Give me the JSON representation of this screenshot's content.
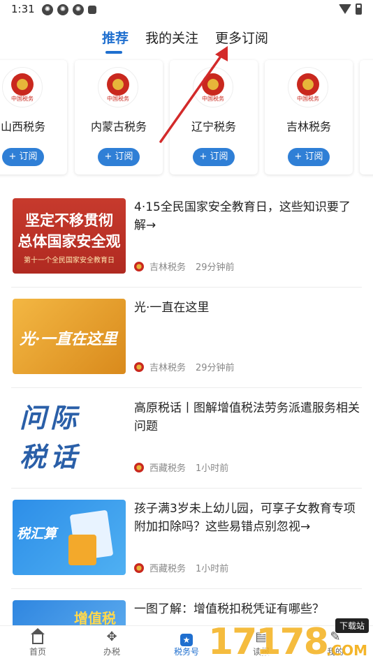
{
  "status": {
    "time": "1:31"
  },
  "tabs": [
    {
      "label": "推荐",
      "active": true
    },
    {
      "label": "我的关注",
      "active": false
    },
    {
      "label": "更多订阅",
      "active": false
    }
  ],
  "subscriptions": [
    {
      "name": "山西税务",
      "button": "+ 订阅"
    },
    {
      "name": "内蒙古税务",
      "button": "+ 订阅"
    },
    {
      "name": "辽宁税务",
      "button": "+ 订阅"
    },
    {
      "name": "吉林税务",
      "button": "+ 订阅"
    }
  ],
  "feed": [
    {
      "title": "4·15全民国家安全教育日，这些知识要了解→",
      "source": "吉林税务",
      "time": "29分钟前",
      "thumb": {
        "line1": "坚定不移贯彻",
        "line2": "总体国家安全观",
        "line3": "第十一个全民国家安全教育日"
      }
    },
    {
      "title": "光·一直在这里",
      "source": "吉林税务",
      "time": "29分钟前",
      "thumb": {
        "text": "光·一直在这里"
      }
    },
    {
      "title": "高原税话丨图解增值税法劳务派遣服务相关问题",
      "source": "西藏税务",
      "time": "1小时前",
      "thumb": {
        "line1": "问际",
        "line2": "税话"
      }
    },
    {
      "title": "孩子满3岁未上幼儿园，可享子女教育专项附加扣除吗？这些易错点别忽视→",
      "source": "西藏税务",
      "time": "1小时前",
      "thumb": {
        "text": "税汇算"
      }
    },
    {
      "title": "一图了解：增值税扣税凭证有哪些？",
      "source": "",
      "time": "",
      "thumb": {
        "text": "增值税"
      }
    }
  ],
  "bottom_nav": [
    {
      "label": "首页",
      "icon": "home-icon"
    },
    {
      "label": "办税",
      "icon": "handshake-icon"
    },
    {
      "label": "税务号",
      "icon": "star-badge-icon",
      "active": true
    },
    {
      "label": "读报",
      "icon": "book-icon"
    },
    {
      "label": "我的",
      "icon": "pen-icon"
    }
  ],
  "watermark": {
    "digits": "17178",
    "tag": "下载站",
    "com": ".COM"
  },
  "colors": {
    "accent": "#1f6fcf",
    "annotation_arrow": "#d32a2a"
  }
}
